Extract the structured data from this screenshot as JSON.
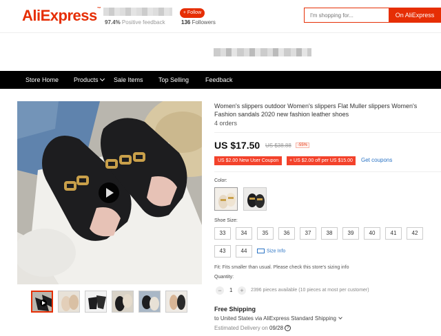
{
  "header": {
    "logo": "AliExpress",
    "positive_feedback_value": "97.4%",
    "positive_feedback_label": "Positive feedback",
    "follow_label": "+ Follow",
    "followers_value": "136",
    "followers_label": "Followers",
    "search_placeholder": "I'm shopping for...",
    "search_button": "On AliExpress"
  },
  "nav": {
    "items": [
      "Store Home",
      "Products",
      "Sale Items",
      "Top Selling",
      "Feedback"
    ]
  },
  "product": {
    "title": "Women's slippers outdoor Women's slippers Flat Muller slippers Women's Fashion sandals 2020 new fashion leather shoes",
    "orders": "4 orders",
    "price": "US $17.50",
    "old_price": "US $38.88",
    "discount": "-55%",
    "coupon_new_user": "US $2.00 New User Coupon",
    "coupon_store": "+ US $2.00 off per US $15.00",
    "get_coupons": "Get coupons",
    "color_label": "Color:",
    "shoe_size_label": "Shoe Size:",
    "sizes": [
      "33",
      "34",
      "35",
      "36",
      "37",
      "38",
      "39",
      "40",
      "41",
      "42",
      "43",
      "44"
    ],
    "size_info": "Size Info",
    "fit_note": "Fit: Fits smaller than usual. Please check this store's sizing info",
    "quantity_label": "Quantity:",
    "quantity_value": "1",
    "qty_minus": "−",
    "qty_plus": "+",
    "availability": "2396 pieces available (10 pieces at most per customer)",
    "free_shipping": "Free Shipping",
    "ship_to": "to United States via AliExpress Standard Shipping",
    "estimated_label": "Estimated Delivery on",
    "estimated_date": "09/28"
  },
  "colors": {
    "brand_red": "#e62e04",
    "link_blue": "#2a73c4",
    "nav_bg": "#000000"
  }
}
